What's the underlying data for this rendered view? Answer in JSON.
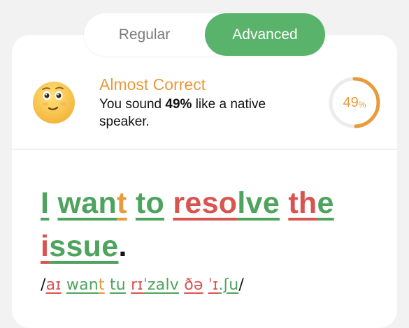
{
  "toggle": {
    "regular_label": "Regular",
    "advanced_label": "Advanced",
    "selected": "Advanced"
  },
  "result": {
    "title": "Almost Correct",
    "desc_prefix": "You sound ",
    "desc_percent": "49%",
    "desc_suffix": " like a native speaker.",
    "score_value": "49",
    "score_unit": "%",
    "score_fraction": 0.49,
    "avatar_icon": "thinking-face-emoji"
  },
  "sentence": {
    "segments": [
      {
        "text": "I",
        "status": "good"
      },
      {
        "text": " ",
        "status": "space"
      },
      {
        "text": "wan",
        "status": "good"
      },
      {
        "text": "t",
        "status": "warn"
      },
      {
        "text": " ",
        "status": "space"
      },
      {
        "text": "to",
        "status": "good"
      },
      {
        "text": " ",
        "status": "space"
      },
      {
        "text": "reso",
        "status": "bad"
      },
      {
        "text": "lve",
        "status": "good"
      },
      {
        "text": " ",
        "status": "space"
      },
      {
        "text": "th",
        "status": "bad"
      },
      {
        "text": "e",
        "status": "good"
      },
      {
        "text": " ",
        "status": "space"
      },
      {
        "text": "i",
        "status": "bad"
      },
      {
        "text": "ssue",
        "status": "good"
      },
      {
        "text": ".",
        "status": "plain"
      }
    ]
  },
  "ipa": {
    "open": "/",
    "close": "/",
    "segments": [
      {
        "text": "aɪ",
        "status": "bad"
      },
      {
        "text": " ",
        "status": "space"
      },
      {
        "text": "wan",
        "status": "good"
      },
      {
        "text": "t",
        "status": "warn"
      },
      {
        "text": " ",
        "status": "space"
      },
      {
        "text": "tu",
        "status": "good"
      },
      {
        "text": " ",
        "status": "space"
      },
      {
        "text": "rɪ",
        "status": "bad"
      },
      {
        "text": "ˈzalv",
        "status": "good"
      },
      {
        "text": " ",
        "status": "space"
      },
      {
        "text": "ðə",
        "status": "bad"
      },
      {
        "text": " ",
        "status": "space"
      },
      {
        "text": "ˈɪ",
        "status": "bad"
      },
      {
        "text": ".ʃu",
        "status": "good"
      }
    ]
  },
  "colors": {
    "accent": "#5ab36a",
    "good": "#4ea35e",
    "warn": "#e99a3a",
    "bad": "#d9534f"
  }
}
